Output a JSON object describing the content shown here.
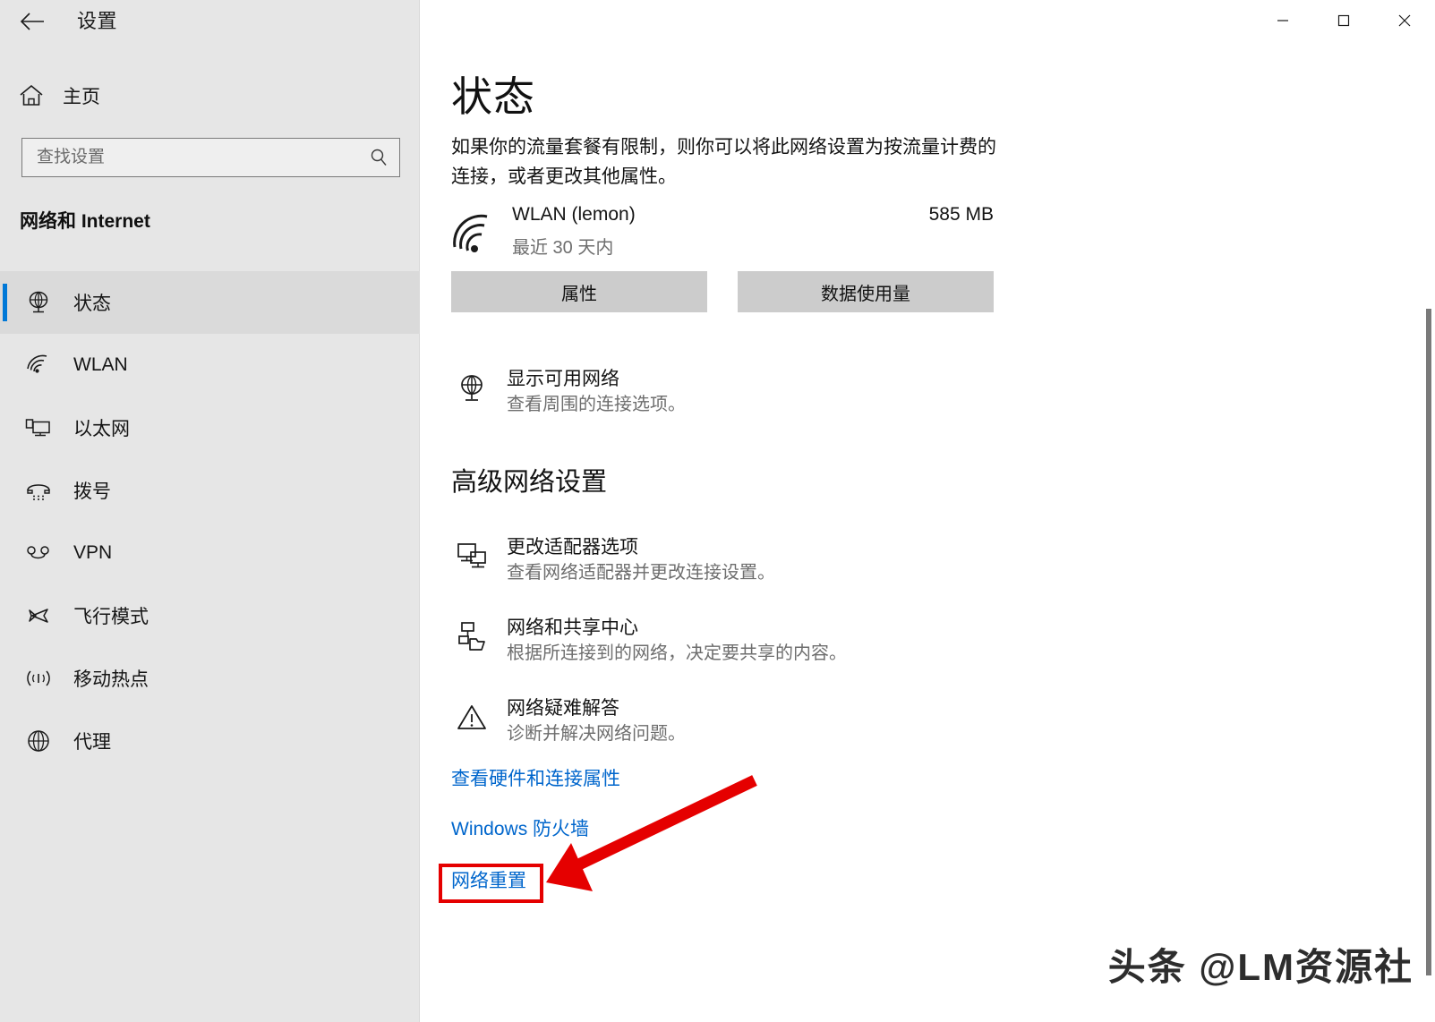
{
  "window": {
    "app_title": "设置",
    "back_icon": "back-arrow-icon",
    "minimize_label": "最小化",
    "maximize_label": "最大化",
    "close_label": "关闭"
  },
  "sidebar": {
    "home_label": "主页",
    "home_icon": "home-icon",
    "search": {
      "placeholder": "查找设置",
      "value": "",
      "icon": "search-icon"
    },
    "group_title": "网络和 Internet",
    "items": [
      {
        "label": "状态",
        "icon": "globe-status-icon",
        "selected": true
      },
      {
        "label": "WLAN",
        "icon": "wifi-icon",
        "selected": false
      },
      {
        "label": "以太网",
        "icon": "ethernet-icon",
        "selected": false
      },
      {
        "label": "拨号",
        "icon": "dialup-phone-icon",
        "selected": false
      },
      {
        "label": "VPN",
        "icon": "vpn-icon",
        "selected": false
      },
      {
        "label": "飞行模式",
        "icon": "airplane-icon",
        "selected": false
      },
      {
        "label": "移动热点",
        "icon": "hotspot-icon",
        "selected": false
      },
      {
        "label": "代理",
        "icon": "proxy-globe-icon",
        "selected": false
      }
    ]
  },
  "main": {
    "page_title": "状态",
    "intro_text": "如果你的流量套餐有限制，则你可以将此网络设置为按流量计费的连接，或者更改其他属性。",
    "connection": {
      "icon": "wifi-signal-icon",
      "name": "WLAN (lemon)",
      "subtitle": "最近 30 天内",
      "usage": "585 MB"
    },
    "buttons": {
      "properties": "属性",
      "data_usage": "数据使用量"
    },
    "available_networks": {
      "icon": "globe-network-icon",
      "title": "显示可用网络",
      "subtitle": "查看周围的连接选项。"
    },
    "section_heading": "高级网络设置",
    "advanced_rows": [
      {
        "icon": "monitor-adapter-icon",
        "title": "更改适配器选项",
        "subtitle": "查看网络适配器并更改连接设置。"
      },
      {
        "icon": "sharing-center-icon",
        "title": "网络和共享中心",
        "subtitle": "根据所连接到的网络，决定要共享的内容。"
      },
      {
        "icon": "warning-triangle-icon",
        "title": "网络疑难解答",
        "subtitle": "诊断并解决网络问题。"
      }
    ],
    "links": [
      {
        "label": "查看硬件和连接属性"
      },
      {
        "label": "Windows 防火墙"
      },
      {
        "label": "网络重置"
      }
    ]
  },
  "annotation": {
    "highlight_color": "#e50000",
    "arrow_icon": "red-arrow-icon",
    "target_link": "网络重置"
  },
  "watermark": {
    "text": "头条 @LM资源社"
  },
  "colors": {
    "accent": "#0078d7",
    "link": "#0066cc",
    "sidebar_bg": "#e6e6e6",
    "button_bg": "#cccccc",
    "annotation_red": "#e50000"
  }
}
